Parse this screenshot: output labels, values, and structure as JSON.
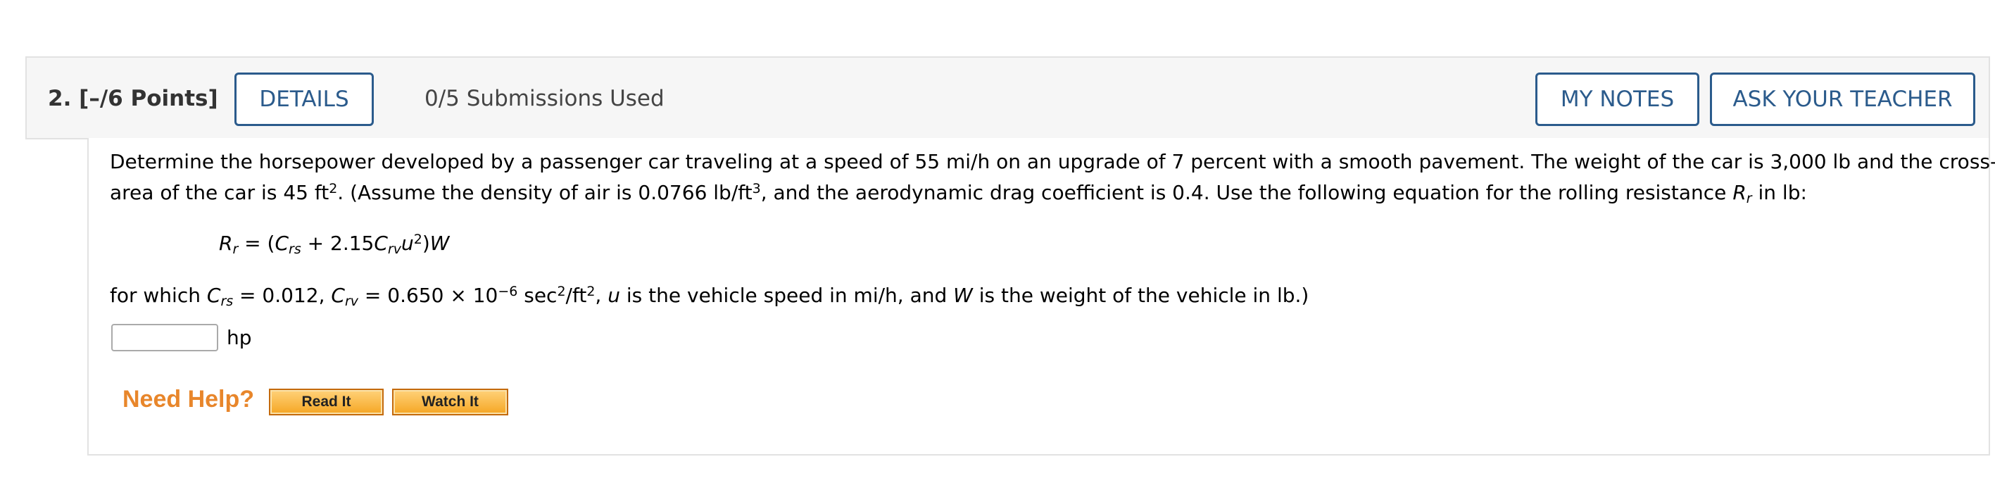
{
  "header": {
    "question_number": "2.",
    "points": "[–/6 Points]",
    "details_label": "DETAILS",
    "submissions": "0/5 Submissions Used",
    "my_notes_label": "MY NOTES",
    "ask_teacher_label": "ASK YOUR TEACHER"
  },
  "problem": {
    "line1": "Determine the horsepower developed by a passenger car traveling at a speed of 55 mi/h on an upgrade of 7 percent with a smooth pavement. The weight of the car is 3,000 lb and the cross-sectional",
    "line2_a": "area of the car is 45 ft",
    "line2_b": ". (Assume the density of air is 0.0766 lb/ft",
    "line2_c": ", and the aerodynamic drag coefficient is 0.4. Use the following equation for the rolling resistance ",
    "line2_d": " in lb:",
    "sup2": "2",
    "sup3": "3",
    "R": "R",
    "r": "r",
    "eq_open": " = (",
    "C": "C",
    "rs": "rs",
    "eq_plus": " + 2.15",
    "rv": "rv",
    "u": "u",
    "eq_close": ")",
    "W": "W",
    "p3_a": "for which ",
    "p3_b": " = 0.012, ",
    "p3_c": " = 0.650 × 10",
    "exp": "−6",
    "p3_d": " sec",
    "p3_e": "/ft",
    "p3_f": ", ",
    "p3_g": " is the vehicle speed in mi/h, and ",
    "p3_h": " is the weight of the vehicle in lb.)"
  },
  "answer": {
    "value": "",
    "unit": "hp"
  },
  "help": {
    "label": "Need Help?",
    "read_it": "Read It",
    "watch_it": "Watch It"
  }
}
